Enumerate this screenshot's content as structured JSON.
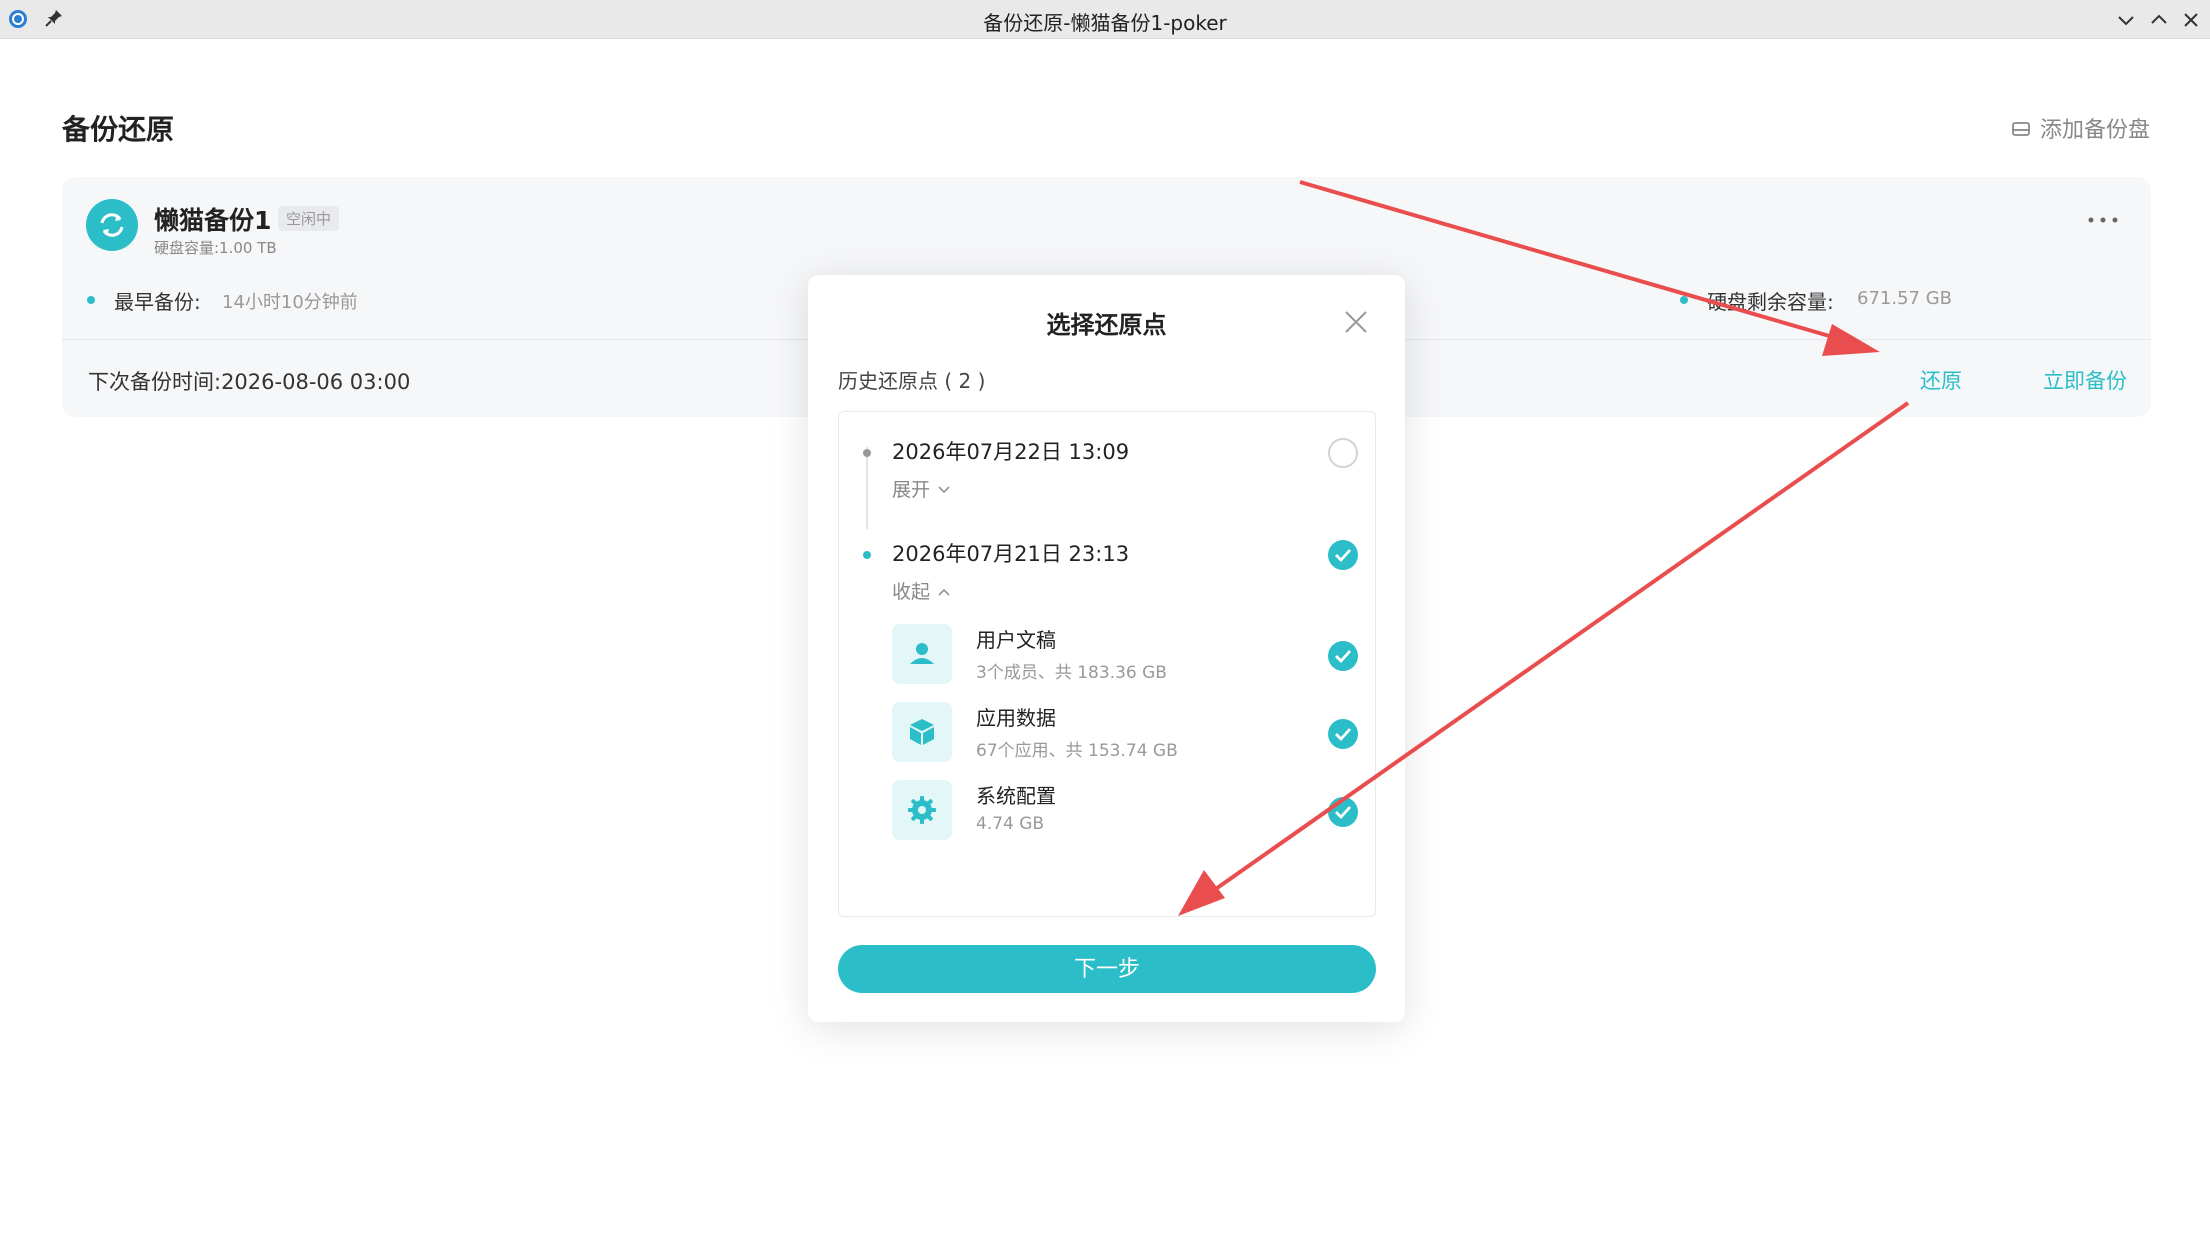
{
  "window": {
    "title": "备份还原-懒猫备份1-poker"
  },
  "page": {
    "title": "备份还原",
    "add_disk_label": "添加备份盘"
  },
  "card": {
    "name": "懒猫备份1",
    "status_badge": "空闲中",
    "capacity": "硬盘容量:1.00 TB",
    "earliest_label": "最早备份:",
    "earliest_value": "14小时10分钟前",
    "remaining_label": "硬盘剩余容量:",
    "remaining_value": "671.57 GB",
    "next_backup": "下次备份时间:2026-08-06 03:00",
    "restore_label": "还原",
    "backup_now_label": "立即备份"
  },
  "modal": {
    "title": "选择还原点",
    "section_label": "历史还原点 ( 2 )",
    "restore_points": [
      {
        "date": "2026年07月22日 13:09",
        "toggle_label": "展开",
        "selected": false
      },
      {
        "date": "2026年07月21日 23:13",
        "toggle_label": "收起",
        "selected": true
      }
    ],
    "items": [
      {
        "name": "用户文稿",
        "meta": "3个成员、共 183.36 GB",
        "icon": "user-icon"
      },
      {
        "name": "应用数据",
        "meta": "67个应用、共 153.74 GB",
        "icon": "cube-icon"
      },
      {
        "name": "系统配置",
        "meta": "4.74 GB",
        "icon": "gear-icon"
      }
    ],
    "next_label": "下一步"
  },
  "colors": {
    "accent": "#2bbec8",
    "annotation_arrow": "#ea4d4d"
  }
}
